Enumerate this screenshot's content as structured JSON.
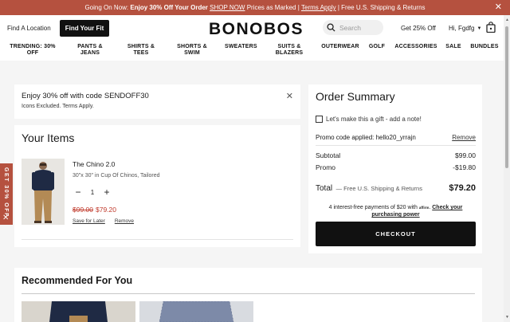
{
  "promo_bar": {
    "prefix": "Going On Now:",
    "highlight": "Enjoy 30% Off Your Order",
    "shop_now": "SHOP NOW",
    "middle": "Prices as Marked |",
    "terms": "Terms Apply",
    "suffix": "| Free U.S. Shipping & Returns",
    "close": "✕"
  },
  "header": {
    "find_location": "Find A Location",
    "find_fit": "Find Your Fit",
    "logo": "BONOBOS",
    "search_placeholder": "Search",
    "get_off": "Get 25% Off",
    "user": "Hi, Fgdfg"
  },
  "nav": {
    "items": [
      {
        "label": "TRENDING: 30% OFF"
      },
      {
        "label": "PANTS & JEANS"
      },
      {
        "label": "SHIRTS & TEES"
      },
      {
        "label": "SHORTS & SWIM"
      },
      {
        "label": "SWEATERS"
      },
      {
        "label": "SUITS & BLAZERS"
      },
      {
        "label": "OUTERWEAR"
      },
      {
        "label": "GOLF"
      },
      {
        "label": "ACCESSORIES"
      },
      {
        "label": "SALE"
      },
      {
        "label": "BUNDLES"
      }
    ]
  },
  "discount": {
    "title": "Enjoy 30% off with code SENDOFF30",
    "subtitle": "Icons Excluded. Terms Apply."
  },
  "items": {
    "title": "Your Items",
    "product": {
      "name": "The Chino 2.0",
      "variant": "30\"x 30\" in Cup Of Chinos, Tailored",
      "quantity": "1",
      "price_old": "$99.00",
      "price_new": "$79.20",
      "save_later": "Save for Later",
      "remove": "Remove"
    }
  },
  "summary": {
    "title": "Order Summary",
    "gift_label": "Let's make this a gift - add a note!",
    "promo_applied": "Promo code applied: hello20_yrrajn",
    "promo_remove": "Remove",
    "subtotal_label": "Subtotal",
    "subtotal_value": "$99.00",
    "promo_label": "Promo",
    "promo_value": "-$19.80",
    "total_label": "Total",
    "total_note": "— Free U.S. Shipping & Returns",
    "total_value": "$79.20",
    "affirm_text": "4 interest-free payments of $20 with",
    "affirm_logo": "affirm",
    "affirm_link_1": "Check your",
    "affirm_link_2": "purchasing power",
    "checkout": "CHECKOUT"
  },
  "recommended": {
    "title": "Recommended For You"
  },
  "side_tab": {
    "label": "GET 30% OFF",
    "close": "✕"
  },
  "colors": {
    "brand_red": "#b5513f",
    "sale_red": "#c0392b",
    "dark": "#111111"
  }
}
